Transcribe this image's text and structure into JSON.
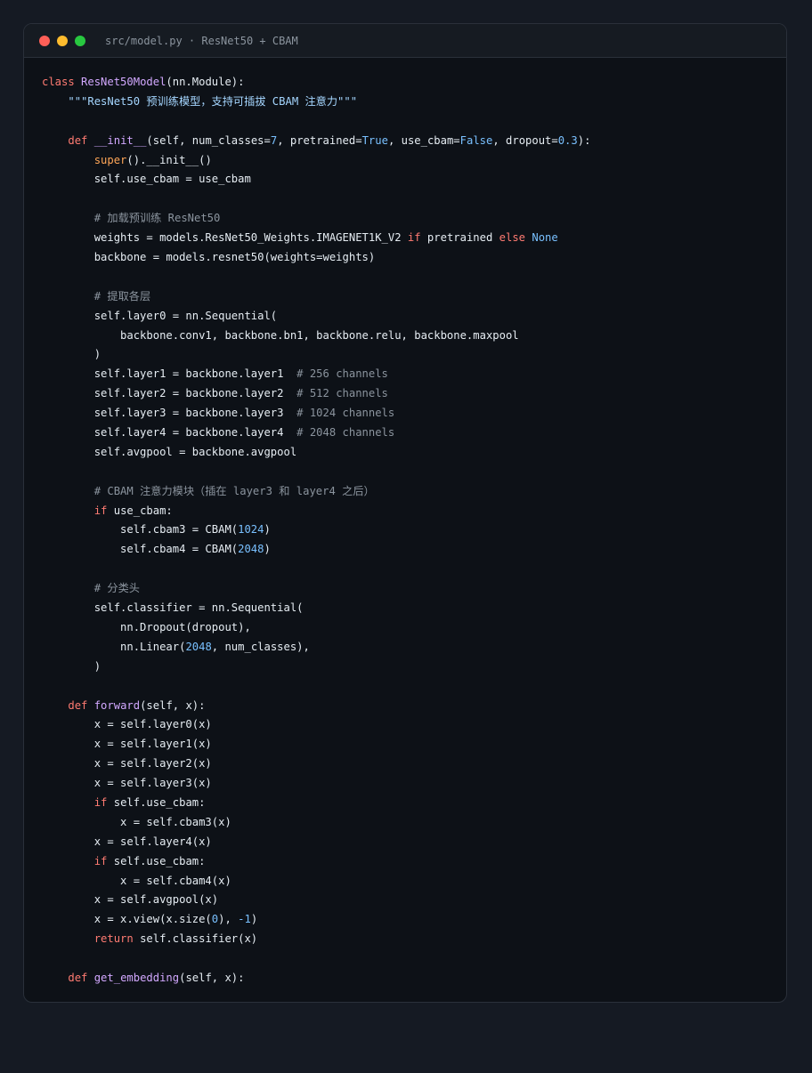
{
  "window": {
    "title": "src/model.py · ResNet50 + CBAM",
    "colors": {
      "close": "#ff5f57",
      "minimize": "#febc2e",
      "maximize": "#28c840",
      "background": "#0d1117"
    }
  },
  "code": {
    "language": "python",
    "lines": [
      [
        [
          "kw",
          "class "
        ],
        [
          "cls",
          "ResNet50Model"
        ],
        [
          "",
          "(nn.Module):"
        ]
      ],
      [
        [
          "",
          "    "
        ],
        [
          "str",
          "\"\"\"ResNet50 预训练模型，支持可插拔 CBAM 注意力\"\"\""
        ]
      ],
      [],
      [
        [
          "",
          "    "
        ],
        [
          "kw",
          "def "
        ],
        [
          "fn",
          "__init__"
        ],
        [
          "",
          "(self, num_classes="
        ],
        [
          "num",
          "7"
        ],
        [
          "",
          ", pretrained="
        ],
        [
          "cst",
          "True"
        ],
        [
          "",
          ", use_cbam="
        ],
        [
          "cst",
          "False"
        ],
        [
          "",
          ", dropout="
        ],
        [
          "num",
          "0.3"
        ],
        [
          "",
          "):"
        ]
      ],
      [
        [
          "",
          "        "
        ],
        [
          "bi",
          "super"
        ],
        [
          "",
          "().__init__()"
        ]
      ],
      [
        [
          "",
          "        self.use_cbam = use_cbam"
        ]
      ],
      [],
      [
        [
          "",
          "        "
        ],
        [
          "cm",
          "# 加载预训练 ResNet50"
        ]
      ],
      [
        [
          "",
          "        weights = models.ResNet50_Weights.IMAGENET1K_V2 "
        ],
        [
          "kw",
          "if"
        ],
        [
          "",
          " pretrained "
        ],
        [
          "kw",
          "else"
        ],
        [
          "",
          ""
        ],
        [
          "cst",
          " None"
        ]
      ],
      [
        [
          "",
          "        backbone = models.resnet50(weights=weights)"
        ]
      ],
      [],
      [
        [
          "",
          "        "
        ],
        [
          "cm",
          "# 提取各层"
        ]
      ],
      [
        [
          "",
          "        self.layer0 = nn.Sequential("
        ]
      ],
      [
        [
          "",
          "            backbone.conv1, backbone.bn1, backbone.relu, backbone.maxpool"
        ]
      ],
      [
        [
          "",
          "        )"
        ]
      ],
      [
        [
          "",
          "        self.layer1 = backbone.layer1  "
        ],
        [
          "cm",
          "# 256 channels"
        ]
      ],
      [
        [
          "",
          "        self.layer2 = backbone.layer2  "
        ],
        [
          "cm",
          "# 512 channels"
        ]
      ],
      [
        [
          "",
          "        self.layer3 = backbone.layer3  "
        ],
        [
          "cm",
          "# 1024 channels"
        ]
      ],
      [
        [
          "",
          "        self.layer4 = backbone.layer4  "
        ],
        [
          "cm",
          "# 2048 channels"
        ]
      ],
      [
        [
          "",
          "        self.avgpool = backbone.avgpool"
        ]
      ],
      [],
      [
        [
          "",
          "        "
        ],
        [
          "cm",
          "# CBAM 注意力模块（插在 layer3 和 layer4 之后）"
        ]
      ],
      [
        [
          "",
          "        "
        ],
        [
          "kw",
          "if"
        ],
        [
          "",
          " use_cbam:"
        ]
      ],
      [
        [
          "",
          "            self.cbam3 = CBAM("
        ],
        [
          "num",
          "1024"
        ],
        [
          "",
          ")"
        ]
      ],
      [
        [
          "",
          "            self.cbam4 = CBAM("
        ],
        [
          "num",
          "2048"
        ],
        [
          "",
          ")"
        ]
      ],
      [],
      [
        [
          "",
          "        "
        ],
        [
          "cm",
          "# 分类头"
        ]
      ],
      [
        [
          "",
          "        self.classifier = nn.Sequential("
        ]
      ],
      [
        [
          "",
          "            nn.Dropout(dropout),"
        ]
      ],
      [
        [
          "",
          "            nn.Linear("
        ],
        [
          "num",
          "2048"
        ],
        [
          "",
          ", num_classes),"
        ]
      ],
      [
        [
          "",
          "        )"
        ]
      ],
      [],
      [
        [
          "",
          "    "
        ],
        [
          "kw",
          "def "
        ],
        [
          "fn",
          "forward"
        ],
        [
          "",
          "(self, x):"
        ]
      ],
      [
        [
          "",
          "        x = self.layer0(x)"
        ]
      ],
      [
        [
          "",
          "        x = self.layer1(x)"
        ]
      ],
      [
        [
          "",
          "        x = self.layer2(x)"
        ]
      ],
      [
        [
          "",
          "        x = self.layer3(x)"
        ]
      ],
      [
        [
          "",
          "        "
        ],
        [
          "kw",
          "if"
        ],
        [
          "",
          " self.use_cbam:"
        ]
      ],
      [
        [
          "",
          "            x = self.cbam3(x)"
        ]
      ],
      [
        [
          "",
          "        x = self.layer4(x)"
        ]
      ],
      [
        [
          "",
          "        "
        ],
        [
          "kw",
          "if"
        ],
        [
          "",
          " self.use_cbam:"
        ]
      ],
      [
        [
          "",
          "            x = self.cbam4(x)"
        ]
      ],
      [
        [
          "",
          "        x = self.avgpool(x)"
        ]
      ],
      [
        [
          "",
          "        x = x.view(x.size("
        ],
        [
          "num",
          "0"
        ],
        [
          "",
          "), "
        ],
        [
          "num",
          "-1"
        ],
        [
          "",
          ")"
        ]
      ],
      [
        [
          "",
          "        "
        ],
        [
          "kw",
          "return"
        ],
        [
          "",
          " self.classifier(x)"
        ]
      ],
      [],
      [
        [
          "",
          "    "
        ],
        [
          "kw",
          "def "
        ],
        [
          "fn",
          "get_embedding"
        ],
        [
          "",
          "(self, x):"
        ]
      ]
    ]
  }
}
